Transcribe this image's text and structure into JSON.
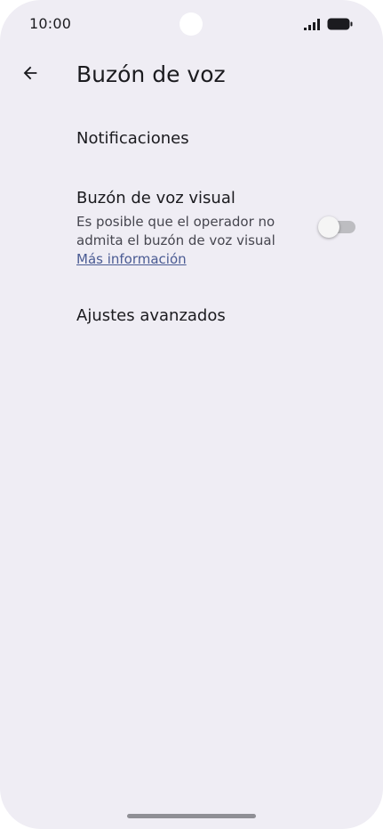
{
  "status_bar": {
    "time": "10:00",
    "signal_icon": "cellular-signal-icon",
    "battery_icon": "battery-full-icon"
  },
  "app_bar": {
    "back_icon": "arrow-back-icon",
    "title": "Buzón de voz"
  },
  "settings": {
    "notifications": {
      "title": "Notificaciones"
    },
    "visual_voicemail": {
      "title": "Buzón de voz visual",
      "summary_line1": "Es posible que el operador no",
      "summary_line2": "admita el buzón de voz visual",
      "link": "Más información",
      "toggle_on": false
    },
    "advanced": {
      "title": "Ajustes avanzados"
    }
  },
  "colors": {
    "background": "#efedf4",
    "text_primary": "#1b1b1f",
    "text_secondary": "#46464f",
    "link": "#4a5b93",
    "toggle_track_off": "#bdbdc1"
  }
}
